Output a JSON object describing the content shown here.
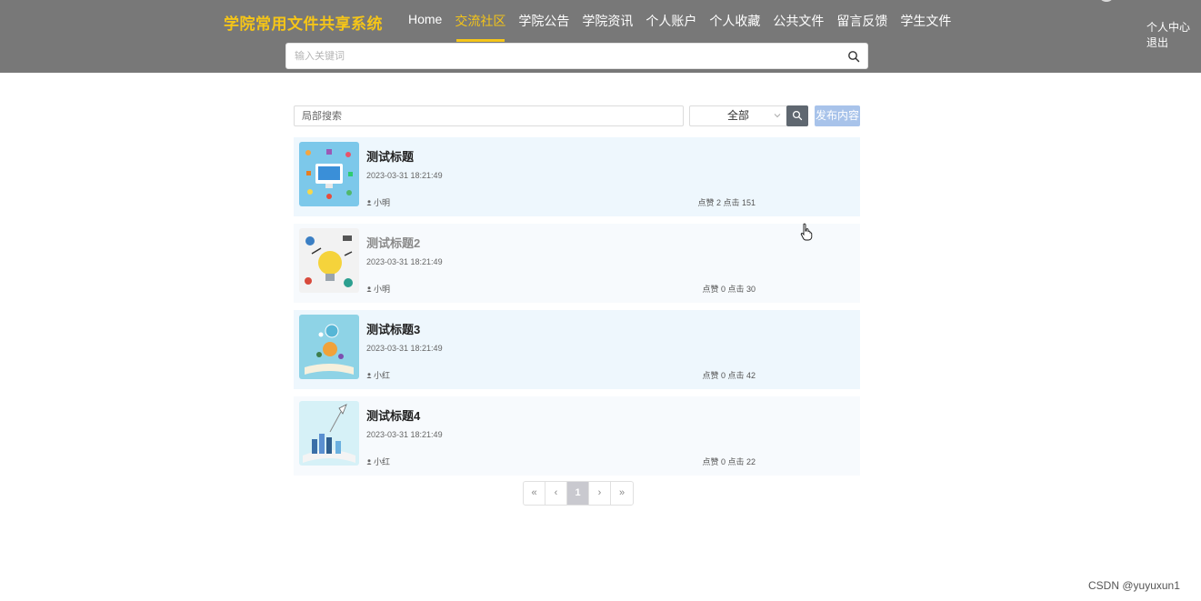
{
  "header": {
    "brand": "学院常用文件共享系统",
    "nav": [
      {
        "label": "Home"
      },
      {
        "label": "交流社区",
        "active": true
      },
      {
        "label": "学院公告"
      },
      {
        "label": "学院资讯"
      },
      {
        "label": "个人账户"
      },
      {
        "label": "个人收藏"
      },
      {
        "label": "公共文件"
      },
      {
        "label": "留言反馈"
      },
      {
        "label": "学生文件"
      }
    ],
    "user_center": "个人中心",
    "logout": "退出",
    "search_placeholder": "输入关键词",
    "accent_color": "#f5c518",
    "bg_color": "#787878"
  },
  "filter": {
    "local_search_placeholder": "局部搜索",
    "category_selected": "全部",
    "publish_label": "发布内容"
  },
  "posts": [
    {
      "title": "测试标题",
      "time": "2023-03-31 18:21:49",
      "author": "小明",
      "stats": "点赞 2 点击 151"
    },
    {
      "title": "测试标题2",
      "time": "2023-03-31 18:21:49",
      "author": "小明",
      "stats": "点赞 0 点击 30"
    },
    {
      "title": "测试标题3",
      "time": "2023-03-31 18:21:49",
      "author": "小红",
      "stats": "点赞 0 点击 42"
    },
    {
      "title": "测试标题4",
      "time": "2023-03-31 18:21:49",
      "author": "小红",
      "stats": "点赞 0 点击 22"
    }
  ],
  "pagination": {
    "first": "«",
    "prev": "‹",
    "current": "1",
    "next": "›",
    "last": "»"
  },
  "watermark": "CSDN @yuyuxun1"
}
